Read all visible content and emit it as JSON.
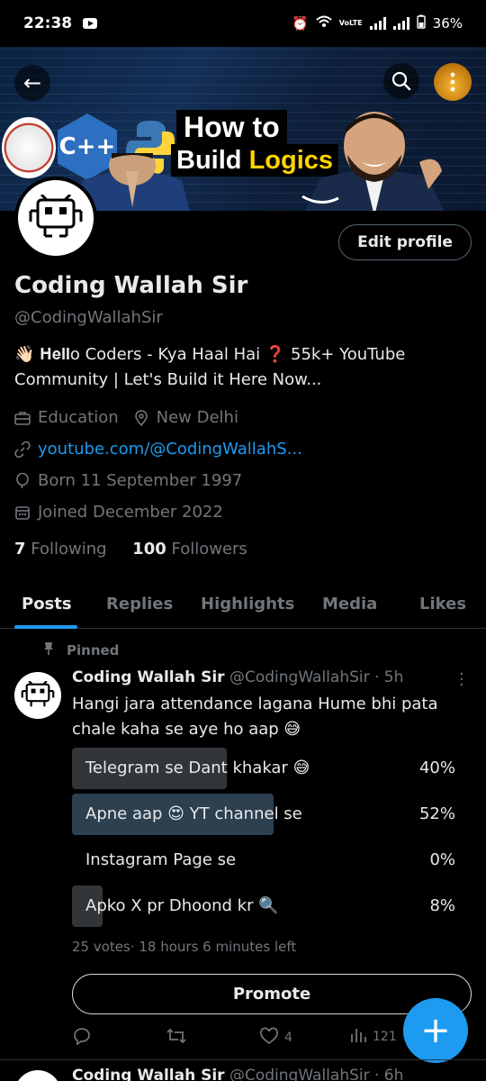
{
  "status_bar": {
    "time": "22:38",
    "network_label": "VoLTE",
    "battery": "36%"
  },
  "banner": {
    "title_line1": "How to",
    "title_line2_a": "Build",
    "title_line2_b": "Logics",
    "cpp_label": "C++"
  },
  "profile": {
    "name": "Coding Wallah Sir",
    "handle": "@CodingWallahSir",
    "edit_label": "Edit profile",
    "bio": "👋🏻 𝐇𝐞𝐥𝐥o Coders - Kya Haal Hai ❓  55k+ YouTube Community | Let's Build it Here Now...",
    "category": "Education",
    "location": "New Delhi",
    "link": "youtube.com/@CodingWallahS...",
    "born": "Born 11 September 1997",
    "joined": "Joined December 2022",
    "following_count": "7",
    "following_label": "Following",
    "followers_count": "100",
    "followers_label": "Followers"
  },
  "tabs": [
    "Posts",
    "Replies",
    "Highlights",
    "Media",
    "Likes"
  ],
  "post": {
    "pinned_label": "Pinned",
    "author": "Coding Wallah Sir",
    "handle_time": "@CodingWallahSir · 5h",
    "text": "Hangi jara attendance lagana Hume bhi pata chale kaha se aye ho aap 😅",
    "poll": [
      {
        "label": "Telegram se Dant khakar 😅",
        "percent_text": "40%",
        "percent": 40
      },
      {
        "label": "Apne aap  😍 YT channel se",
        "percent_text": "52%",
        "percent": 52
      },
      {
        "label": "Instagram Page se",
        "percent_text": "0%",
        "percent": 0
      },
      {
        "label": "Apko X pr Dhoond kr 🔍",
        "percent_text": "8%",
        "percent": 8
      }
    ],
    "poll_meta": "25 votes· 18 hours 6 minutes left",
    "promote_label": "Promote",
    "likes": "4",
    "views": "121"
  },
  "next_post": {
    "author": "Coding Wallah Sir",
    "handle_time": "@CodingWallahSir · 6h"
  },
  "colors": {
    "accent": "#1d9bf0",
    "muted": "#71767b",
    "text": "#e7e9ea",
    "background": "#000000"
  }
}
